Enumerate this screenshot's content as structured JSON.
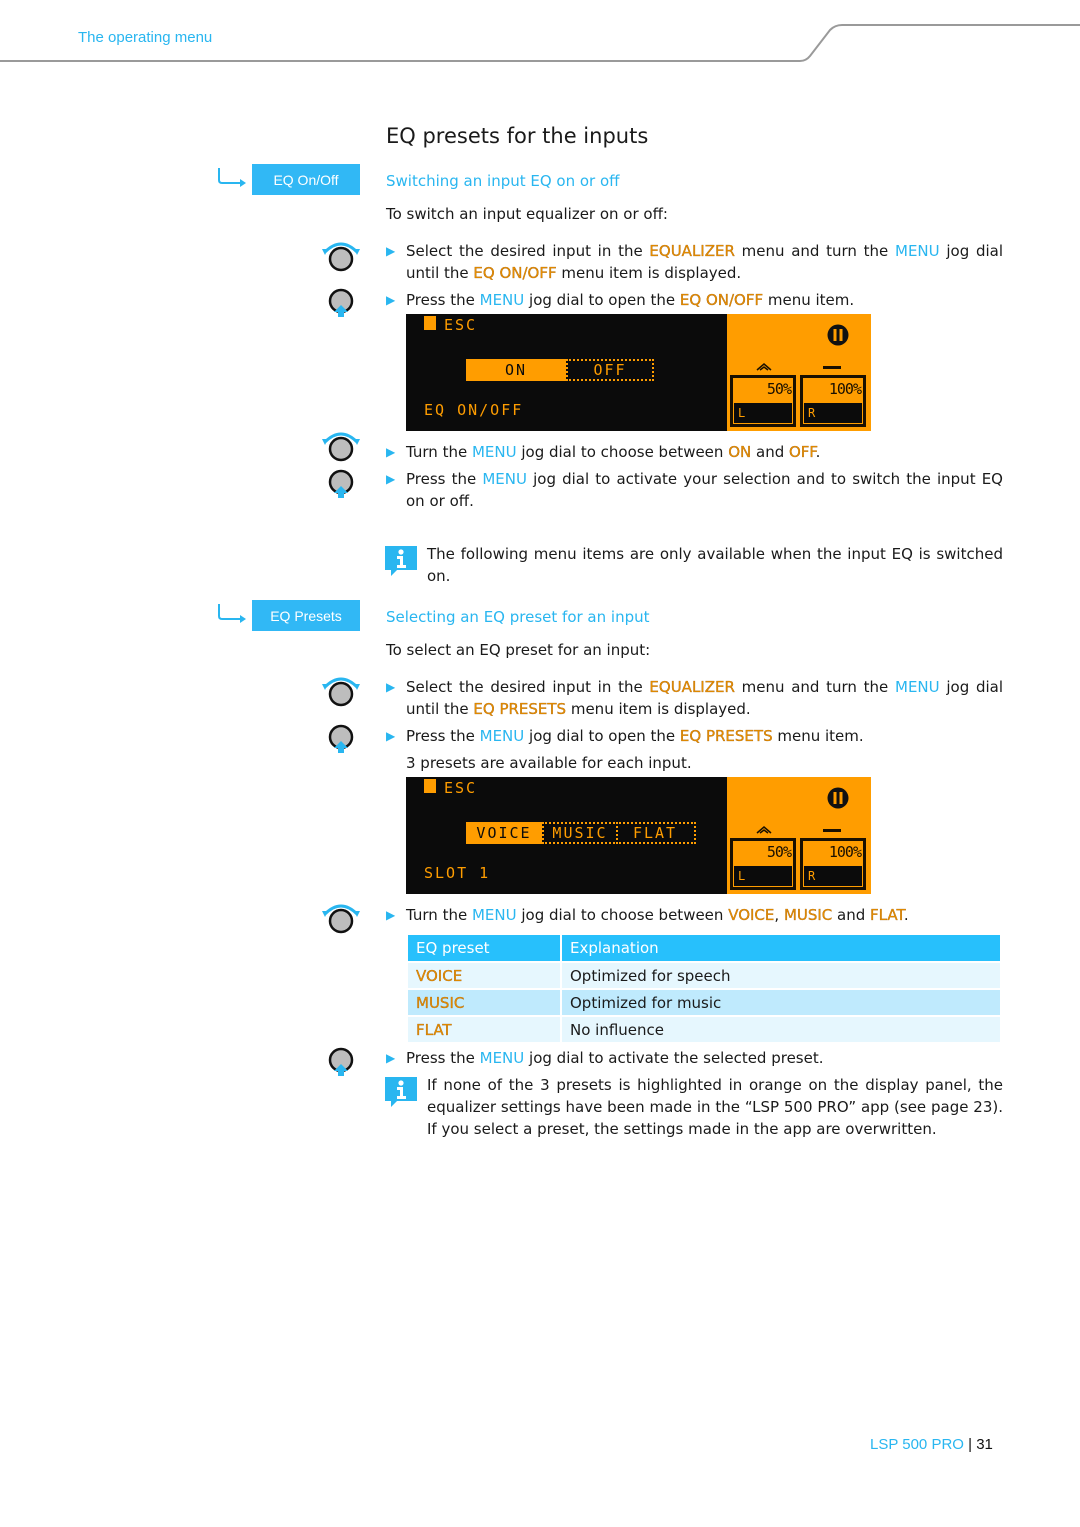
{
  "header": {
    "section_title": "The operating menu"
  },
  "page_title": "EQ presets for the inputs",
  "colors": {
    "accent_blue": "#29b6f0",
    "keyword_orange": "#e88f00",
    "lcd_orange": "#ff9d00",
    "table_header": "#27c0fc"
  },
  "section1": {
    "menu_tag": "EQ On/Off",
    "heading": "Switching an input EQ on or off",
    "intro": "To switch an input equalizer on or off:",
    "step1": {
      "a": "Select the desired input in the ",
      "kw1": "EQUALIZER",
      "b": " menu and turn the ",
      "kw2": "MENU",
      "c": " jog dial until the ",
      "kw3": "EQ ON/OFF",
      "d": " menu item is displayed."
    },
    "step2": {
      "a": "Press the ",
      "kw1": "MENU",
      "b": " jog dial to open the ",
      "kw2": "EQ ON/OFF",
      "c": " menu item."
    },
    "display": {
      "esc": "ESC",
      "options": [
        "ON",
        "OFF"
      ],
      "selected": "ON",
      "footer_label": "EQ ON/OFF",
      "meter_left": {
        "value": "50%",
        "channel": "L"
      },
      "meter_right": {
        "value": "100%",
        "channel": "R"
      }
    },
    "step3": {
      "a": "Turn the ",
      "kw1": "MENU",
      "b": " jog dial to choose between ",
      "kw2": "ON",
      "c": " and ",
      "kw3": "OFF",
      "d": "."
    },
    "step4": {
      "a": "Press the ",
      "kw1": "MENU",
      "b": " jog dial to activate your selection and to switch the input EQ on or off."
    },
    "note": "The following menu items are only available when the input EQ is switched on."
  },
  "section2": {
    "menu_tag": "EQ Presets",
    "heading": "Selecting an EQ preset for an input",
    "intro": "To select an EQ preset for an input:",
    "step1": {
      "a": "Select the desired input in the ",
      "kw1": "EQUALIZER",
      "b": " menu and turn the ",
      "kw2": "MENU",
      "c": " jog dial until the ",
      "kw3": "EQ PRESETS",
      "d": " menu item is displayed."
    },
    "step2": {
      "a": "Press the ",
      "kw1": "MENU",
      "b": " jog dial to open the ",
      "kw2": "EQ PRESETS",
      "c": " menu item."
    },
    "step2_result": "3 presets are available for each input.",
    "display": {
      "esc": "ESC",
      "options": [
        "VOICE",
        "MUSIC",
        "FLAT"
      ],
      "selected": "VOICE",
      "footer_label": "SLOT 1",
      "meter_left": {
        "value": "50%",
        "channel": "L"
      },
      "meter_right": {
        "value": "100%",
        "channel": "R"
      }
    },
    "step3": {
      "a": "Turn the ",
      "kw1": "MENU",
      "b": " jog dial to choose between ",
      "kw2": "VOICE",
      "c": ", ",
      "kw3": "MUSIC",
      "d": " and ",
      "kw4": "FLAT",
      "e": "."
    },
    "table": {
      "headers": [
        "EQ preset",
        "Explanation"
      ],
      "rows": [
        {
          "preset": "VOICE",
          "explanation": "Optimized for speech"
        },
        {
          "preset": "MUSIC",
          "explanation": "Optimized for music"
        },
        {
          "preset": "FLAT",
          "explanation": "No influence"
        }
      ]
    },
    "step4": {
      "a": "Press the ",
      "kw1": "MENU",
      "b": " jog dial to activate the selected preset."
    },
    "note": "If none of the 3 presets is highlighted in orange on the display panel, the equalizer settings have been made in the “LSP 500 PRO” app (see page 23). If you select a preset, the settings made in the app are overwritten."
  },
  "footer": {
    "product": "LSP 500 PRO",
    "separator": "|",
    "page_number": "31"
  }
}
